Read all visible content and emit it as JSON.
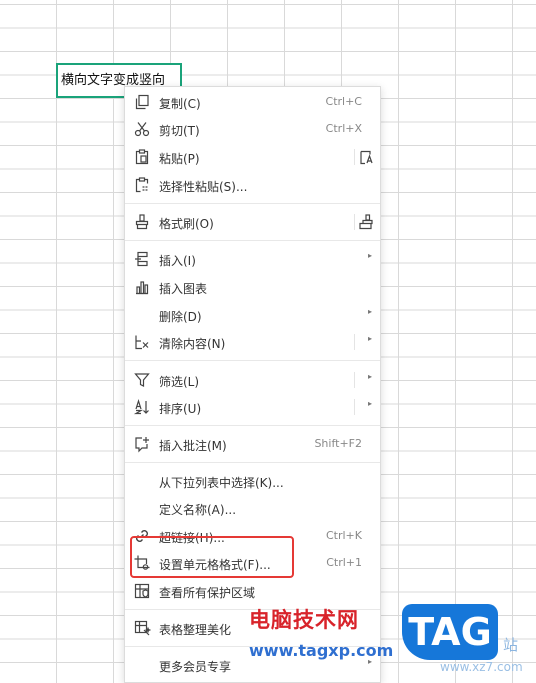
{
  "cell": {
    "text": "横向文字变成竖向"
  },
  "menu": {
    "items": [
      {
        "id": "copy",
        "icon": "copy-icon",
        "label": "复制(C)",
        "shortcut": "Ctrl+C"
      },
      {
        "id": "cut",
        "icon": "scissors-icon",
        "label": "剪切(T)",
        "shortcut": "Ctrl+X"
      },
      {
        "id": "paste",
        "icon": "paste-icon",
        "label": "粘贴(P)",
        "side_icon": "paste-text-only-icon"
      },
      {
        "id": "paste-special",
        "icon": "paste-special-icon",
        "label": "选择性粘贴(S)..."
      },
      {
        "id": "format-painter",
        "icon": "format-painter-icon",
        "label": "格式刷(O)",
        "side_icon": "format-painter-alt-icon"
      },
      {
        "id": "insert",
        "icon": "insert-icon",
        "label": "插入(I)",
        "submenu": true
      },
      {
        "id": "insert-chart",
        "icon": "chart-icon",
        "label": "插入图表"
      },
      {
        "id": "delete",
        "icon": "",
        "label": "删除(D)",
        "submenu": true
      },
      {
        "id": "clear",
        "icon": "clear-icon",
        "label": "清除内容(N)",
        "submenu": true
      },
      {
        "id": "filter",
        "icon": "filter-icon",
        "label": "筛选(L)",
        "submenu": true
      },
      {
        "id": "sort",
        "icon": "sort-icon",
        "label": "排序(U)",
        "submenu": true
      },
      {
        "id": "insert-comment",
        "icon": "comment-icon",
        "label": "插入批注(M)",
        "shortcut": "Shift+F2"
      },
      {
        "id": "pick-from-list",
        "icon": "",
        "label": "从下拉列表中选择(K)..."
      },
      {
        "id": "define-name",
        "icon": "",
        "label": "定义名称(A)..."
      },
      {
        "id": "hyperlink",
        "icon": "link-icon",
        "label": "超链接(H)...",
        "shortcut": "Ctrl+K"
      },
      {
        "id": "format-cells",
        "icon": "format-cells-icon",
        "label": "设置单元格格式(F)...",
        "shortcut": "Ctrl+1"
      },
      {
        "id": "protected-areas",
        "icon": "shield-icon",
        "label": "查看所有保护区域"
      },
      {
        "id": "beautify",
        "icon": "beautify-icon",
        "label": "表格整理美化"
      },
      {
        "id": "more-member",
        "icon": "",
        "label": "更多会员专享",
        "submenu": true
      }
    ],
    "submenu_arrow": "▸"
  },
  "watermark": {
    "brand": "电脑技术网",
    "url": "www.tagxp.com",
    "logo": "TAG",
    "site": "站",
    "url2": "www.xz7.com"
  },
  "colors": {
    "selection_border": "#1aa37a",
    "highlight_box": "#e53935",
    "watermark_red": "#d8232a",
    "watermark_blue": "#1677d9"
  }
}
